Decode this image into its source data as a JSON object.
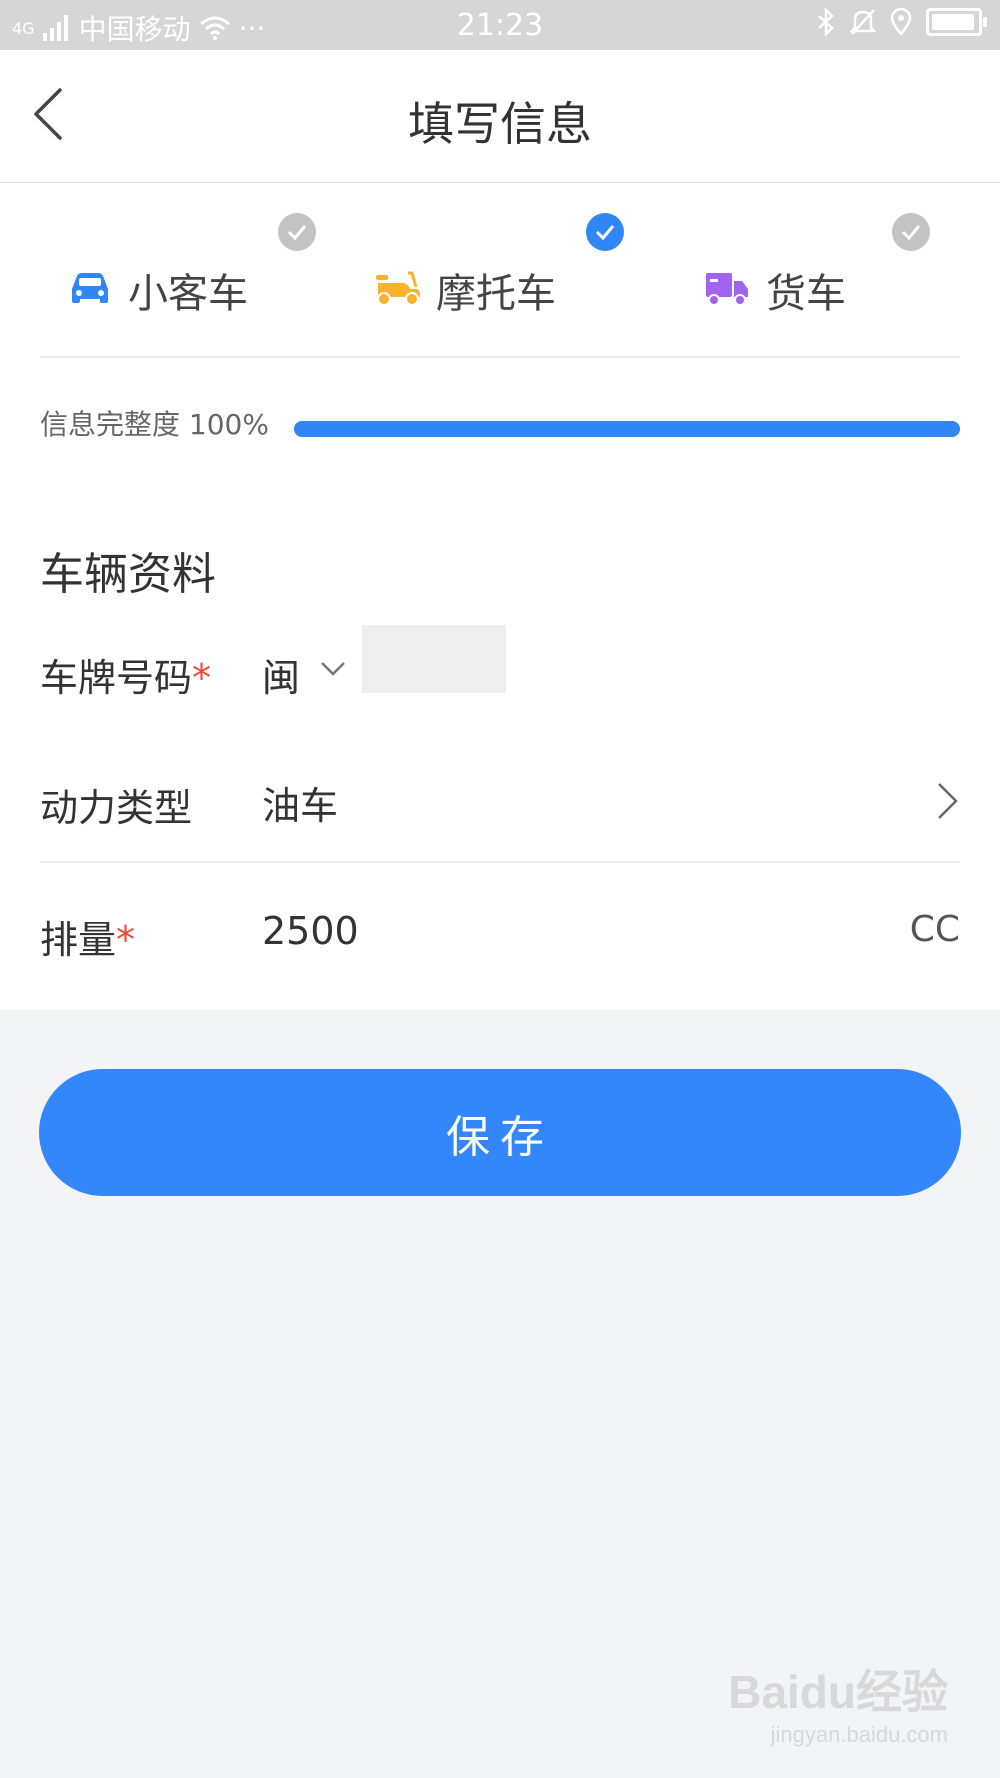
{
  "status_bar": {
    "network": "4G",
    "carrier": "中国移动",
    "more": "···",
    "time": "21:23"
  },
  "header": {
    "title": "填写信息"
  },
  "vehicle_types": [
    {
      "label": "小客车",
      "selected": false,
      "icon": "car-icon",
      "color": "#2f86f6"
    },
    {
      "label": "摩托车",
      "selected": true,
      "icon": "motorcycle-icon",
      "color": "#f8b32a"
    },
    {
      "label": "货车",
      "selected": false,
      "icon": "truck-icon",
      "color": "#a064f0"
    }
  ],
  "progress": {
    "label": "信息完整度 100%",
    "percent": 100
  },
  "section": {
    "title": "车辆资料"
  },
  "fields": {
    "plate": {
      "label": "车牌号码",
      "required_mark": "*",
      "prefix": "闽"
    },
    "power": {
      "label": "动力类型",
      "value": "油车"
    },
    "displacement": {
      "label": "排量",
      "required_mark": "*",
      "value": "2500",
      "unit": "CC"
    }
  },
  "save_label": "保存",
  "watermark": {
    "main": "Baidu经验",
    "sub": "jingyan.baidu.com"
  },
  "colors": {
    "accent": "#3387fb",
    "required": "#ef4a3a"
  }
}
